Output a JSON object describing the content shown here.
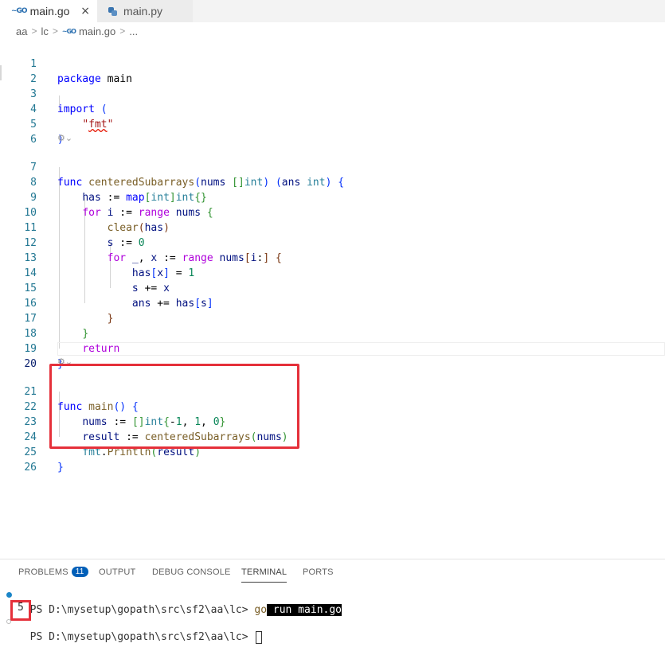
{
  "tabs": [
    {
      "label": "main.go",
      "icon": "go-file-icon",
      "active": true
    },
    {
      "label": "main.py",
      "icon": "python-file-icon",
      "active": false
    }
  ],
  "tab_close_glyph": "×",
  "go_icon_text": "GO",
  "breadcrumb": {
    "items": [
      "aa",
      "lc",
      "main.go",
      "..."
    ]
  },
  "editor": {
    "line_numbers": [
      "1",
      "2",
      "3",
      "4",
      "5",
      "6",
      "7",
      "8",
      "9",
      "10",
      "11",
      "12",
      "13",
      "14",
      "15",
      "16",
      "17",
      "18",
      "19",
      "20",
      "21",
      "22",
      "23",
      "24",
      "25",
      "26"
    ]
  },
  "panel": {
    "tabs": [
      "PROBLEMS",
      "OUTPUT",
      "DEBUG CONSOLE",
      "TERMINAL",
      "PORTS"
    ],
    "active_tab": "TERMINAL",
    "problems_count": "11",
    "terminal": {
      "prompt": "PS D:\\mysetup\\gopath\\src\\sf2\\aa\\lc> ",
      "cmd_head": "go",
      "cmd_tail": " run main.go",
      "output": "5"
    }
  },
  "colors": {
    "keyword": "#0000ff",
    "control_keyword": "#af00db",
    "function": "#795e26",
    "string": "#a31515",
    "number": "#098658",
    "variable": "#001080",
    "type": "#267f99",
    "highlight_box": "#e5303a",
    "badge": "#005fb8"
  }
}
